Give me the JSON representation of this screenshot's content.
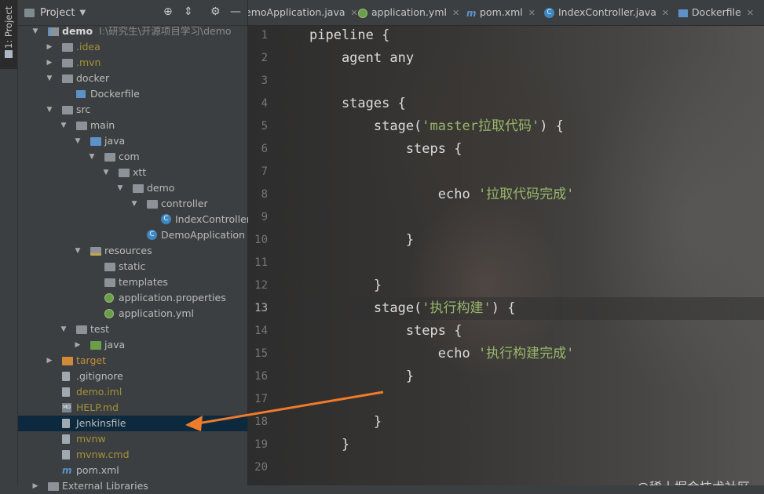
{
  "stripe": {
    "label": "1: Project"
  },
  "project": {
    "title": "Project",
    "tree": [
      {
        "label": "demo",
        "extra": "I:\\研究生\\开源项目学习\\demo",
        "depth": 0,
        "arrow": "down",
        "icon": "module",
        "style": "bold",
        "name": "tree-item-demo"
      },
      {
        "label": ".idea",
        "depth": 1,
        "arrow": "right",
        "icon": "folder",
        "style": "olive",
        "name": "tree-item-idea"
      },
      {
        "label": ".mvn",
        "depth": 1,
        "arrow": "right",
        "icon": "folder",
        "style": "olive",
        "name": "tree-item-mvn"
      },
      {
        "label": "docker",
        "depth": 1,
        "arrow": "down",
        "icon": "folder",
        "style": "gray",
        "name": "tree-item-docker"
      },
      {
        "label": "Dockerfile",
        "depth": 2,
        "arrow": "",
        "icon": "docker",
        "style": "gray",
        "name": "tree-item-dockerfile"
      },
      {
        "label": "src",
        "depth": 1,
        "arrow": "down",
        "icon": "folder",
        "style": "gray",
        "name": "tree-item-src"
      },
      {
        "label": "main",
        "depth": 2,
        "arrow": "down",
        "icon": "folder",
        "style": "gray",
        "name": "tree-item-main"
      },
      {
        "label": "java",
        "depth": 3,
        "arrow": "down",
        "icon": "folder-blue",
        "style": "gray",
        "name": "tree-item-java"
      },
      {
        "label": "com",
        "depth": 4,
        "arrow": "down",
        "icon": "folder",
        "style": "gray",
        "name": "tree-item-com"
      },
      {
        "label": "xtt",
        "depth": 5,
        "arrow": "down",
        "icon": "folder",
        "style": "gray",
        "name": "tree-item-xtt"
      },
      {
        "label": "demo",
        "depth": 6,
        "arrow": "down",
        "icon": "folder",
        "style": "gray",
        "name": "tree-item-demo-package"
      },
      {
        "label": "controller",
        "depth": 7,
        "arrow": "down",
        "icon": "folder",
        "style": "gray",
        "name": "tree-item-controller"
      },
      {
        "label": "IndexController",
        "depth": 8,
        "arrow": "",
        "icon": "class",
        "style": "gray",
        "name": "tree-item-indexcontroller"
      },
      {
        "label": "DemoApplication",
        "depth": 7,
        "arrow": "",
        "icon": "class",
        "style": "gray",
        "name": "tree-item-demoapplication"
      },
      {
        "label": "resources",
        "depth": 3,
        "arrow": "down",
        "icon": "folder-res",
        "style": "gray",
        "name": "tree-item-resources"
      },
      {
        "label": "static",
        "depth": 4,
        "arrow": "",
        "icon": "folder",
        "style": "gray",
        "name": "tree-item-static"
      },
      {
        "label": "templates",
        "depth": 4,
        "arrow": "",
        "icon": "folder",
        "style": "gray",
        "name": "tree-item-templates"
      },
      {
        "label": "application.properties",
        "depth": 4,
        "arrow": "",
        "icon": "config",
        "style": "gray",
        "name": "tree-item-application-properties"
      },
      {
        "label": "application.yml",
        "depth": 4,
        "arrow": "",
        "icon": "config",
        "style": "gray",
        "name": "tree-item-application-yml"
      },
      {
        "label": "test",
        "depth": 2,
        "arrow": "down",
        "icon": "folder",
        "style": "gray",
        "name": "tree-item-test"
      },
      {
        "label": "java",
        "depth": 3,
        "arrow": "right",
        "icon": "folder-green",
        "style": "gray",
        "name": "tree-item-test-java"
      },
      {
        "label": "target",
        "depth": 1,
        "arrow": "right",
        "icon": "folder-orange",
        "style": "orange",
        "name": "tree-item-target"
      },
      {
        "label": ".gitignore",
        "depth": 1,
        "arrow": "",
        "icon": "file",
        "style": "gray",
        "name": "tree-item-gitignore"
      },
      {
        "label": "demo.iml",
        "depth": 1,
        "arrow": "",
        "icon": "file",
        "style": "olive",
        "name": "tree-item-demo-iml"
      },
      {
        "label": "HELP.md",
        "depth": 1,
        "arrow": "",
        "icon": "md",
        "style": "olive",
        "name": "tree-item-help-md"
      },
      {
        "label": "Jenkinsfile",
        "depth": 1,
        "arrow": "",
        "icon": "file",
        "style": "gray",
        "selected": true,
        "name": "tree-item-jenkinsfile"
      },
      {
        "label": "mvnw",
        "depth": 1,
        "arrow": "",
        "icon": "file",
        "style": "olive",
        "name": "tree-item-mvnw"
      },
      {
        "label": "mvnw.cmd",
        "depth": 1,
        "arrow": "",
        "icon": "file",
        "style": "olive",
        "name": "tree-item-mvnw-cmd"
      },
      {
        "label": "pom.xml",
        "depth": 1,
        "arrow": "",
        "icon": "maven",
        "style": "gray",
        "name": "tree-item-pom-xml"
      },
      {
        "label": "External Libraries",
        "depth": 0,
        "arrow": "right",
        "icon": "folder",
        "style": "gray",
        "name": "tree-item-external-libraries"
      }
    ]
  },
  "tabs": [
    {
      "label": "emoApplication.java",
      "icon": "",
      "name": "tab-demoapplication"
    },
    {
      "label": "application.yml",
      "icon": "config",
      "name": "tab-application-yml"
    },
    {
      "label": "pom.xml",
      "icon": "maven",
      "name": "tab-pom-xml"
    },
    {
      "label": "IndexController.java",
      "icon": "class",
      "name": "tab-indexcontroller"
    },
    {
      "label": "Dockerfile",
      "icon": "docker",
      "name": "tab-dockerfile"
    }
  ],
  "editor": {
    "current_line": 13,
    "lines": [
      [
        {
          "t": "pipeline {"
        }
      ],
      [
        {
          "t": "    agent any"
        }
      ],
      [
        {
          "t": ""
        }
      ],
      [
        {
          "t": "    stages {"
        }
      ],
      [
        {
          "t": "        stage("
        },
        {
          "t": "'master拉取代码'",
          "c": "str"
        },
        {
          "t": ") {"
        }
      ],
      [
        {
          "t": "            steps {"
        }
      ],
      [
        {
          "t": ""
        }
      ],
      [
        {
          "t": "                echo "
        },
        {
          "t": "'拉取代码完成'",
          "c": "str"
        }
      ],
      [
        {
          "t": ""
        }
      ],
      [
        {
          "t": "            }"
        }
      ],
      [
        {
          "t": ""
        }
      ],
      [
        {
          "t": "        }"
        }
      ],
      [
        {
          "t": "        stage("
        },
        {
          "t": "'执行构建'",
          "c": "str"
        },
        {
          "t": ") {"
        }
      ],
      [
        {
          "t": "            steps {"
        }
      ],
      [
        {
          "t": "                echo "
        },
        {
          "t": "'执行构建完成'",
          "c": "str"
        }
      ],
      [
        {
          "t": "            }"
        }
      ],
      [
        {
          "t": ""
        }
      ],
      [
        {
          "t": "        }"
        }
      ],
      [
        {
          "t": "    }"
        }
      ],
      [
        {
          "t": ""
        }
      ]
    ]
  },
  "watermark": "@稀土掘金技术社区",
  "colors": {
    "accent_arrow": "#f07b2a",
    "string": "#98b86b",
    "selection": "#0d293e"
  }
}
